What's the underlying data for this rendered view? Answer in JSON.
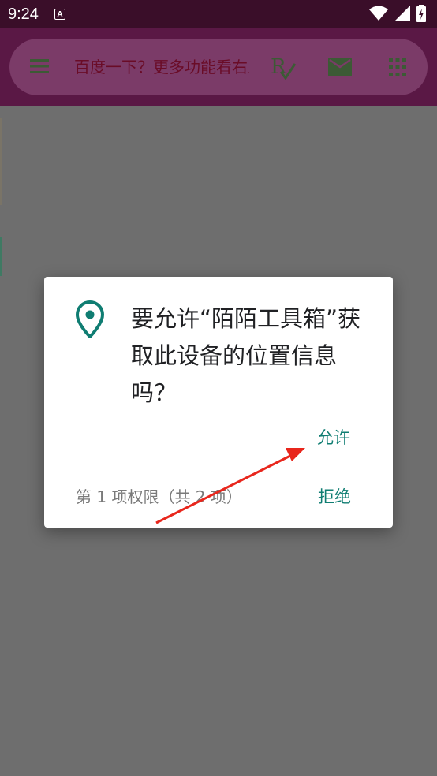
{
  "status_bar": {
    "time": "9:24",
    "notification_icon_letter": "A"
  },
  "app_bar": {
    "search_text": "百度一下？更多功能看右上角",
    "accent_color": "#5a1845"
  },
  "dialog": {
    "title": "要允许“陌陌工具箱”获取此设备的位置信息吗？",
    "allow_label": "允许",
    "deny_label": "拒绝",
    "permission_count": "第 1 项权限（共 2 项）",
    "button_color": "#0f7d72"
  },
  "icons": {
    "menu": "menu-icon",
    "rx": "rx-icon",
    "mail": "mail-icon",
    "grid": "grid-icon",
    "location": "location-pin-icon"
  }
}
